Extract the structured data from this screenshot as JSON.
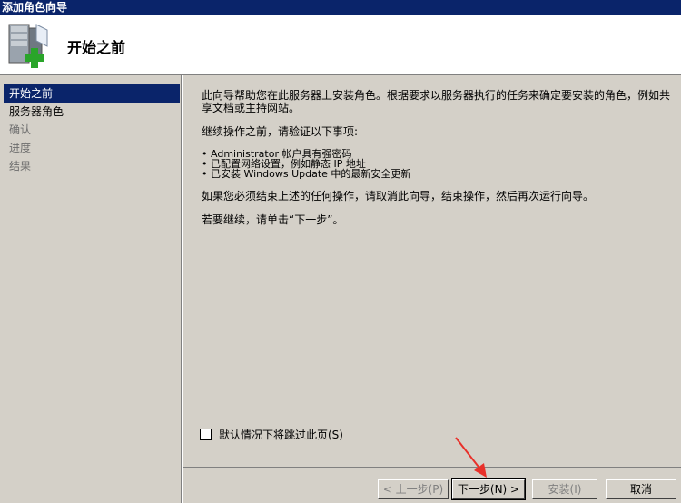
{
  "window": {
    "title": "添加角色向导"
  },
  "header": {
    "title": "开始之前",
    "icon": "server-add-icon"
  },
  "sidebar": {
    "items": [
      {
        "label": "开始之前",
        "state": "selected"
      },
      {
        "label": "服务器角色",
        "state": "enabled"
      },
      {
        "label": "确认",
        "state": "disabled"
      },
      {
        "label": "进度",
        "state": "disabled"
      },
      {
        "label": "结果",
        "state": "disabled"
      }
    ]
  },
  "content": {
    "intro": "此向导帮助您在此服务器上安装角色。根据要求以服务器执行的任务来确定要安装的角色，例如共享文档或主持网站。",
    "verify_heading": "继续操作之前，请验证以下事项:",
    "checklist": [
      "Administrator 帐户具有强密码",
      "已配置网络设置，例如静态 IP 地址",
      "已安装 Windows Update 中的最新安全更新"
    ],
    "cancel_note": "如果您必须结束上述的任何操作，请取消此向导，结束操作，然后再次运行向导。",
    "continue_note": "若要继续，请单击“下一步”。"
  },
  "skip_checkbox": {
    "label": "默认情况下将跳过此页(S)",
    "checked": false
  },
  "buttons": {
    "back": "< 上一步(P)",
    "next": "下一步(N) >",
    "install": "安装(I)",
    "cancel": "取消"
  },
  "colors": {
    "title_bar": "#0a246a",
    "selection": "#0a246a",
    "annotation_arrow": "#e8302a"
  }
}
